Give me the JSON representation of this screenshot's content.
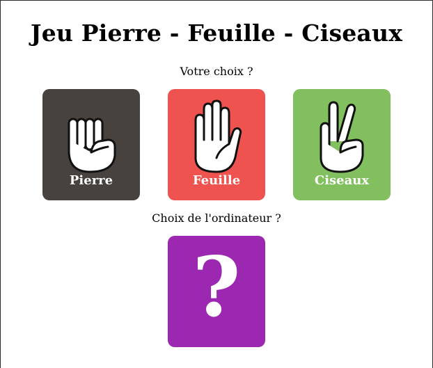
{
  "title": "Jeu Pierre - Feuille - Ciseaux",
  "player_prompt": "Votre choix ?",
  "computer_prompt": "Choix de l'ordinateur ?",
  "choices": [
    {
      "label": "Pierre",
      "icon": "fist-icon",
      "color": "#47423e"
    },
    {
      "label": "Feuille",
      "icon": "open-hand-icon",
      "color": "#ef5350"
    },
    {
      "label": "Ciseaux",
      "icon": "peace-hand-icon",
      "color": "#82bf5e"
    }
  ],
  "computer_choice": {
    "symbol": "?",
    "color": "#9c27b0"
  }
}
